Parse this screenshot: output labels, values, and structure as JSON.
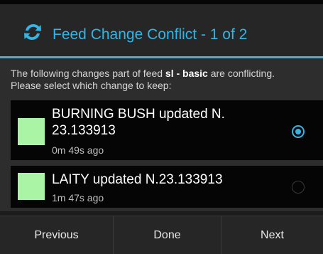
{
  "dialog": {
    "title": "Feed Change Conflict - 1 of 2",
    "title_icon": "sync-arrows-icon",
    "accent_color": "#33b5e5"
  },
  "message": {
    "line1_prefix": "The following changes part of feed ",
    "feed_name": "sl - basic",
    "line1_suffix": " are conflicting.",
    "line2": "Please select which change to keep:"
  },
  "changes": [
    {
      "title": "BURNING BUSH updated N. 23.133913",
      "time": "0m 49s ago",
      "swatch_color": "#a9f5a5",
      "selected": true
    },
    {
      "title": "LAITY updated N.23.133913",
      "time": "1m 47s ago",
      "swatch_color": "#a9f5a5",
      "selected": false
    }
  ],
  "buttons": {
    "previous": "Previous",
    "done": "Done",
    "next": "Next"
  }
}
